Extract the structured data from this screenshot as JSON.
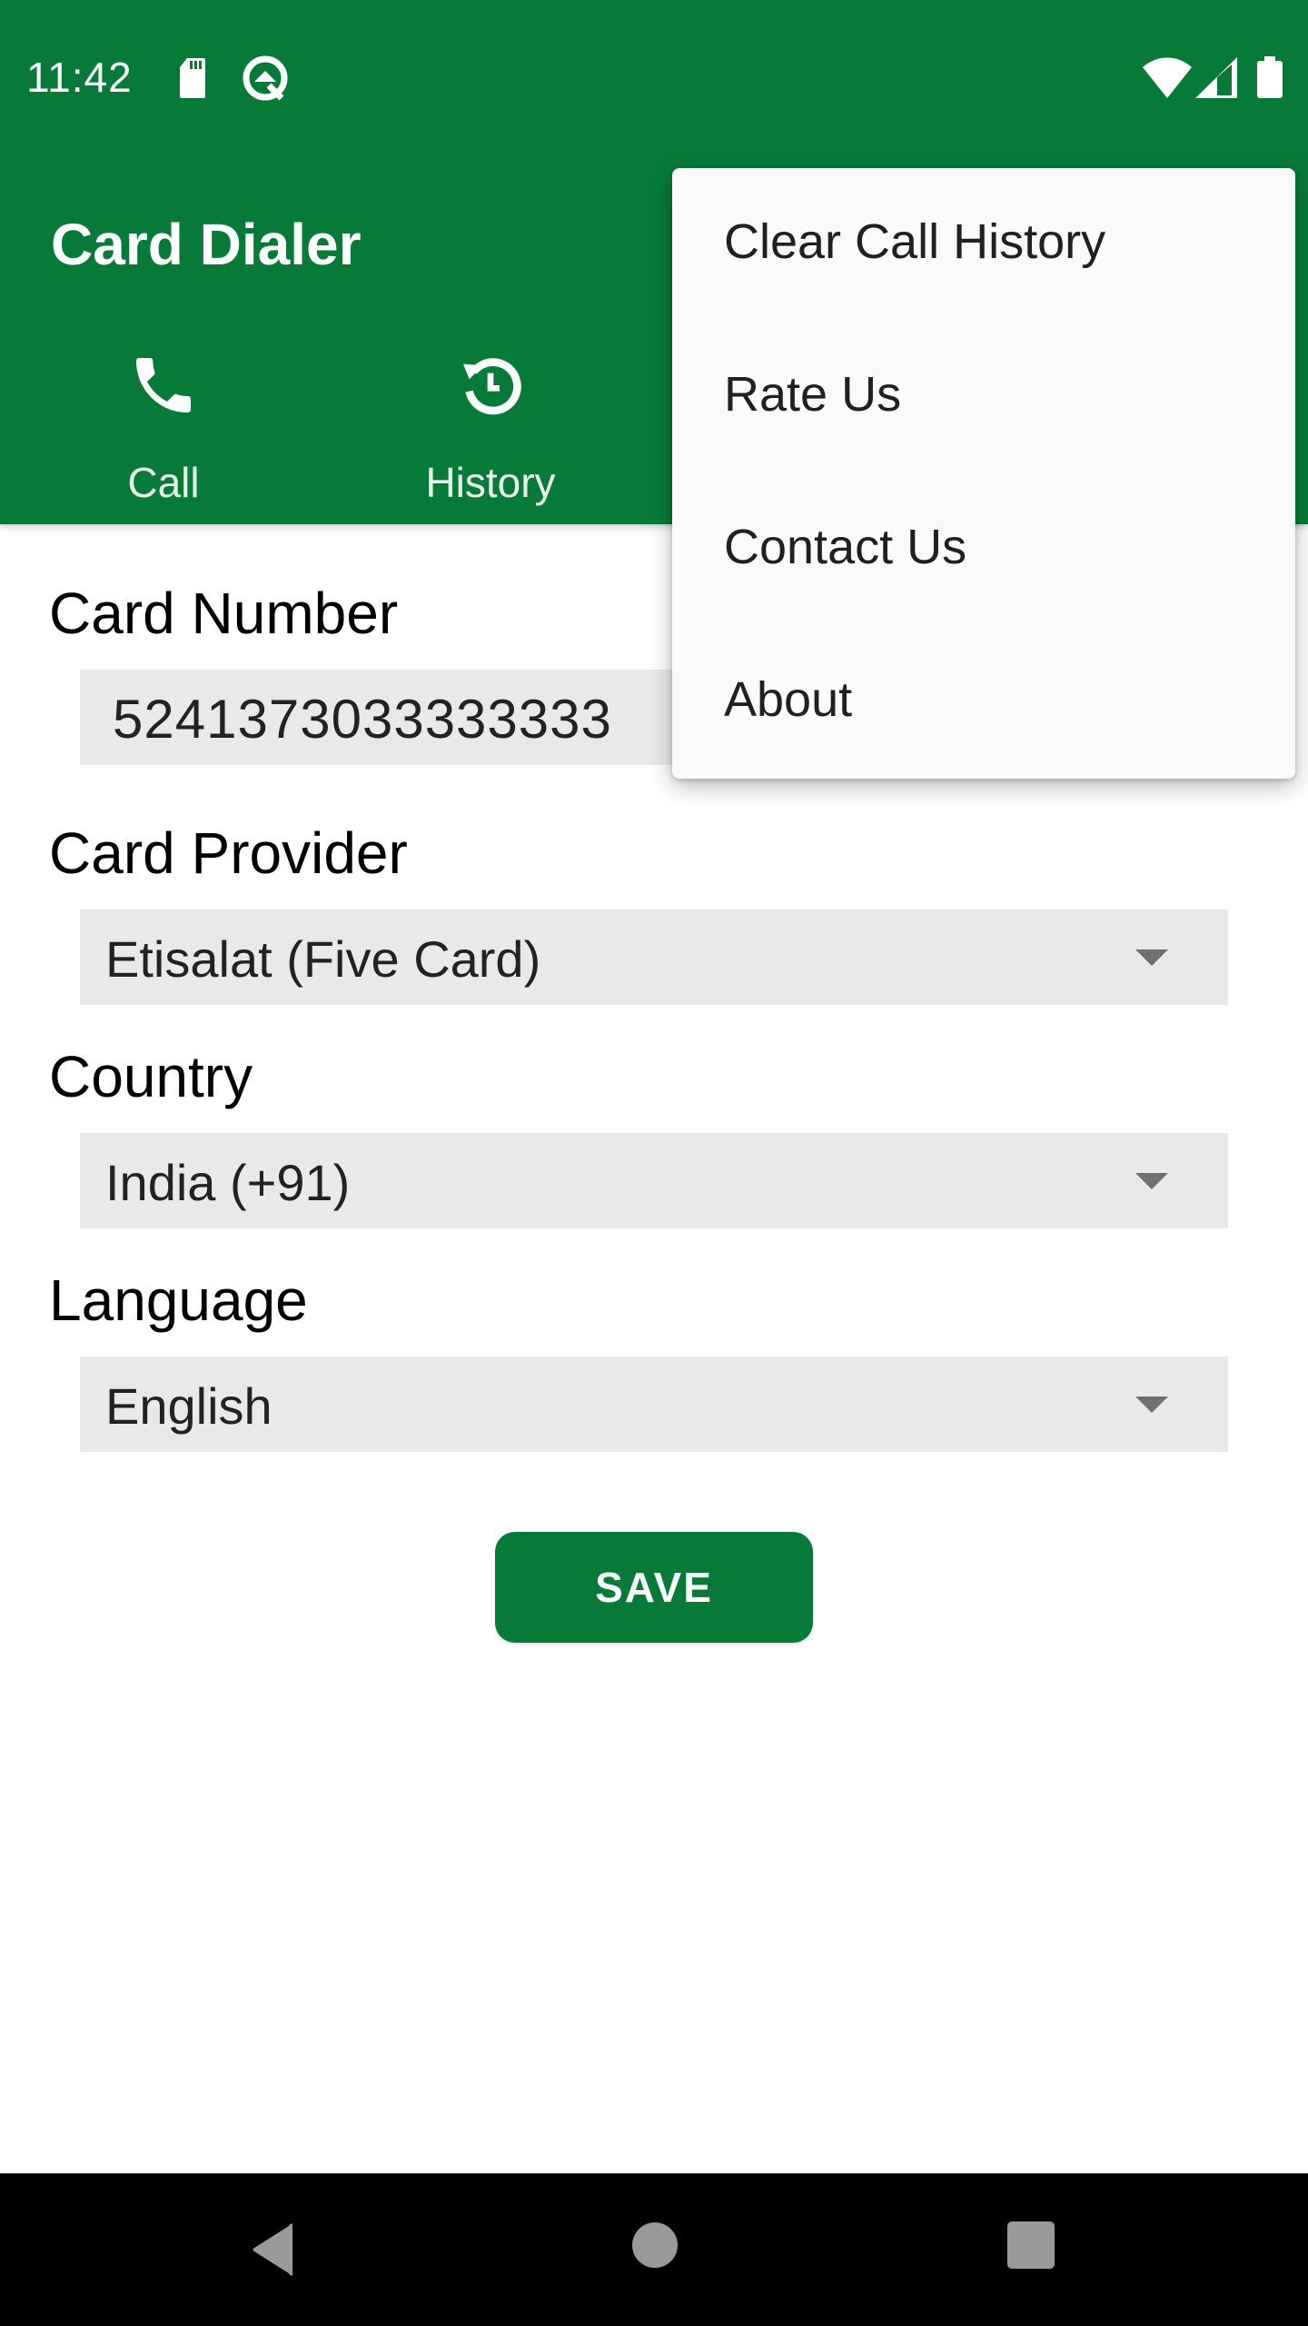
{
  "status_bar": {
    "time": "11:42",
    "left_icons": [
      "sd-card-icon",
      "android-q-icon"
    ],
    "right_icons": [
      "wifi-icon",
      "cell-signal-icon",
      "battery-icon"
    ]
  },
  "app_bar": {
    "title": "Card Dialer",
    "tabs": [
      {
        "label": "Call",
        "icon": "phone-icon"
      },
      {
        "label": "History",
        "icon": "history-icon"
      }
    ]
  },
  "form": {
    "card_number": {
      "label": "Card Number",
      "value": "5241373033333333"
    },
    "card_provider": {
      "label": "Card Provider",
      "selected": "Etisalat (Five Card)"
    },
    "country": {
      "label": "Country",
      "selected": "India (+91)"
    },
    "language": {
      "label": "Language",
      "selected": "English"
    },
    "save_label": "SAVE"
  },
  "overflow_menu": {
    "items": [
      {
        "label": "Clear Call History"
      },
      {
        "label": "Rate Us"
      },
      {
        "label": "Contact Us"
      },
      {
        "label": "About"
      }
    ]
  },
  "nav_bar": {
    "buttons": [
      "back-icon",
      "home-icon",
      "recents-icon"
    ]
  },
  "colors": {
    "primary": "#087a38",
    "field_background": "#ebe9e8",
    "menu_background": "#fafafa"
  }
}
